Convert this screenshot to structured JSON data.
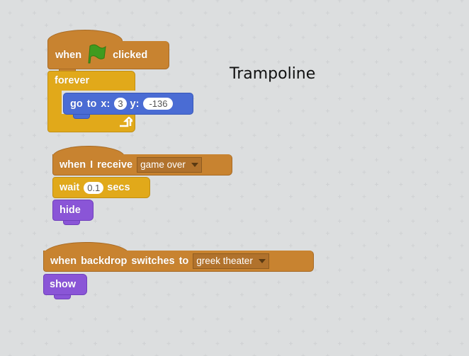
{
  "canvas": {
    "title_label": "Trampoline",
    "background_color": "#dcdedf"
  },
  "colors": {
    "events": "#c88330",
    "control": "#e1a91a",
    "motion": "#4a6cd4",
    "looks": "#8a55d7",
    "flag": "#3f9b1f"
  },
  "scripts": [
    {
      "hat": {
        "label_before": "when",
        "icon": "green-flag-icon",
        "label_after": "clicked"
      },
      "forever": {
        "label": "forever",
        "icon": "loop-arrow-icon"
      },
      "goto": {
        "label_go": "go",
        "label_to": "to",
        "label_x": "x:",
        "x_value": "3",
        "label_y": "y:",
        "y_value": "-136"
      }
    },
    {
      "hat": {
        "label_when": "when",
        "label_i": "I",
        "label_receive": "receive",
        "message": "game over"
      },
      "wait": {
        "label": "wait",
        "value": "0.1",
        "unit": "secs"
      },
      "hide": {
        "label": "hide"
      }
    },
    {
      "hat": {
        "label_when": "when",
        "label_backdrop": "backdrop",
        "label_switches": "switches",
        "label_to": "to",
        "backdrop": "greek theater"
      },
      "show": {
        "label": "show"
      }
    }
  ]
}
